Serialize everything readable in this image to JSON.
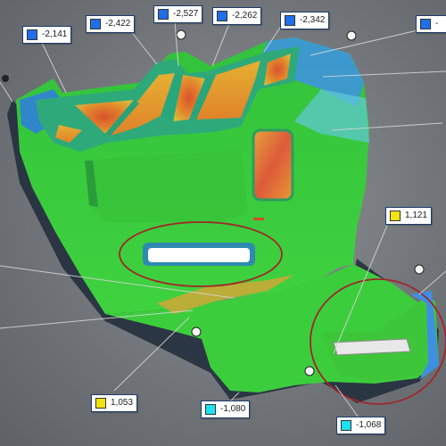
{
  "colors": {
    "background": "#74787c",
    "nominal_green": "#39c43a",
    "deviation_blue": "#1866e0",
    "deviation_cyan": "#1ee6f0",
    "deviation_yellow": "#f0e61e",
    "deviation_orange": "#e0892a",
    "deviation_red": "#d8322a",
    "highlight_circle": "#a1262a"
  },
  "callouts": [
    {
      "id": "c1",
      "value": "-2,141",
      "swatch": "#1f6fe8"
    },
    {
      "id": "c2",
      "value": "-2,422",
      "swatch": "#1f6fe8"
    },
    {
      "id": "c3",
      "value": "-2,527",
      "swatch": "#1f6fe8"
    },
    {
      "id": "c4",
      "value": "-2,262",
      "swatch": "#1f6fe8"
    },
    {
      "id": "c5",
      "value": "-2,342",
      "swatch": "#1f6fe8"
    },
    {
      "id": "c6",
      "value": "-",
      "swatch": "#1f6fe8"
    },
    {
      "id": "c7",
      "value": "1,121",
      "swatch": "#f2e312"
    },
    {
      "id": "c8",
      "value": "1,053",
      "swatch": "#f2e312"
    },
    {
      "id": "c9",
      "value": "-1,080",
      "swatch": "#1ee0f0"
    },
    {
      "id": "c10",
      "value": "-1,068",
      "swatch": "#1ee0f0"
    }
  ]
}
